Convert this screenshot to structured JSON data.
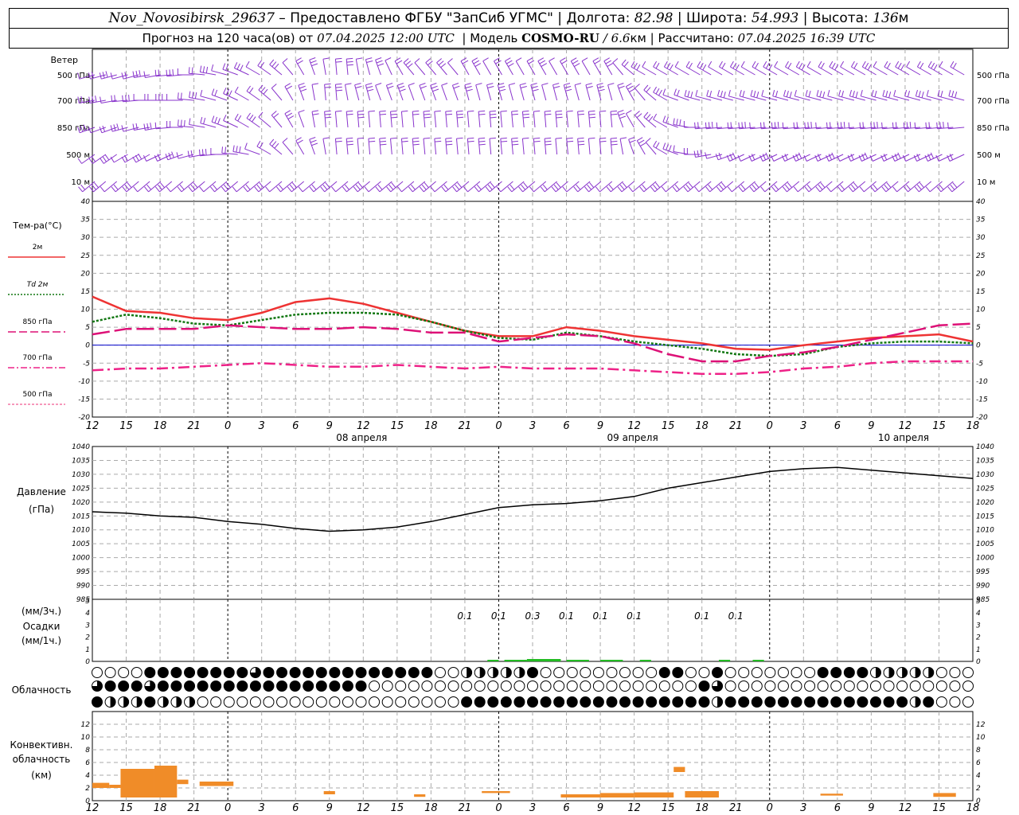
{
  "header": {
    "station": "Nov_Novosibirsk_29637",
    "dash": "–",
    "provided": "Предоставлено ФГБУ \"ЗапСиб УГМС\"",
    "lon_label": "Долгота:",
    "lon": "82.98",
    "lat_label": "Широта:",
    "lat": "54.993",
    "alt_label": "Высота:",
    "alt": "136",
    "alt_unit": "м",
    "sep": "|",
    "forecast_label": "Прогноз на 120 часа(ов) от",
    "run_time": "07.04.2025 12:00 UTC",
    "model_label": "| Модель",
    "model": "COSMO-RU",
    "slash": "/",
    "res": "6.6",
    "res_unit": "км",
    "calc_label": "| Рассчитано:",
    "calc_time": "07.04.2025 16:39 UTC"
  },
  "colors": {
    "t2m": "#ee3333",
    "td2m": "#117711",
    "t850": "#dd1177",
    "t700": "#ee2288",
    "t500": "#ee3377",
    "wind": "#8833cc",
    "pressure": "#000000",
    "zero": "#0000cc",
    "conv": "#f08c28",
    "precip": "#22bb22"
  },
  "wind_panel": {
    "title": "Ветер",
    "levels": [
      "500 гПа",
      "700 гПа",
      "850 гПа",
      "500 м",
      "10  м"
    ]
  },
  "temp_panel": {
    "title": "Тем-ра(°C)",
    "legend": [
      {
        "label": "2м",
        "key": "t2m",
        "style": "solid"
      },
      {
        "label": "Td  2м",
        "key": "td2m",
        "style": "dotted"
      },
      {
        "label": "850 гПа",
        "key": "t850",
        "style": "dash"
      },
      {
        "label": "700 гПа",
        "key": "t700",
        "style": "dashdot"
      },
      {
        "label": "500 гПа",
        "key": "t500",
        "style": "thin"
      }
    ]
  },
  "x_ticks": [
    "12",
    "15",
    "18",
    "21",
    "0",
    "3",
    "6",
    "9",
    "12",
    "15",
    "18",
    "21",
    "0",
    "3",
    "6",
    "9",
    "12",
    "15",
    "18",
    "21",
    "0",
    "3",
    "6",
    "9",
    "12",
    "15",
    "18"
  ],
  "dates": [
    "08 апреля",
    "09 апреля",
    "10 апреля"
  ],
  "pressure_panel": {
    "title": "Давление",
    "unit": "(гПа)"
  },
  "precip_panel": {
    "unit1": "(мм/3ч.)",
    "title": "Осадки",
    "unit2": "(мм/1ч.)",
    "labels": [
      "0.1",
      "0.1",
      "0.3",
      "0.1",
      "0.1",
      "0.1",
      "0.1",
      "0.1"
    ]
  },
  "cloud_panel": {
    "title": "Облачность",
    "rows": [
      "0000444444443444444444444400222224000000000440040000000444422222000",
      "3444344444444444444440000000000000000000000000430000000000000000000",
      "4222422200000000000000000000444444444444444444424444444444444424000"
    ]
  },
  "conv_panel": {
    "title_lines": [
      "Конвективн.",
      "облачность",
      "(км)"
    ]
  },
  "chart_data": [
    {
      "type": "line",
      "title": "Тем-ра(°C)",
      "x": [
        "07.04 12",
        "07.04 15",
        "07.04 18",
        "07.04 21",
        "08.04 00",
        "08.04 03",
        "08.04 06",
        "08.04 09",
        "08.04 12",
        "08.04 15",
        "08.04 18",
        "08.04 21",
        "09.04 00",
        "09.04 03",
        "09.04 06",
        "09.04 09",
        "09.04 12",
        "09.04 15",
        "09.04 18",
        "09.04 21",
        "10.04 00",
        "10.04 03",
        "10.04 06",
        "10.04 09",
        "10.04 12",
        "10.04 15",
        "10.04 18"
      ],
      "ylim": [
        -20,
        40
      ],
      "yticks": [
        -20,
        -15,
        -10,
        -5,
        0,
        5,
        10,
        15,
        20,
        25,
        30,
        35,
        40
      ],
      "series": [
        {
          "name": "2м",
          "values": [
            13.5,
            9.5,
            9,
            7.5,
            7,
            9,
            12,
            13,
            11.5,
            9,
            6.5,
            4,
            2.5,
            2.5,
            5,
            4,
            2.5,
            1.5,
            0.5,
            -1,
            -1.3,
            0,
            1,
            2,
            2.5,
            3,
            1
          ]
        },
        {
          "name": "Td  2м",
          "values": [
            6.5,
            8.5,
            7.5,
            6,
            5.5,
            7,
            8.5,
            9,
            9,
            8.5,
            6.5,
            4,
            2,
            1.5,
            3.5,
            2.5,
            1,
            0,
            -1,
            -2.5,
            -3,
            -2.5,
            -0.5,
            0.5,
            1,
            1,
            0.5
          ]
        },
        {
          "name": "850 гПа",
          "values": [
            3,
            4.5,
            4.5,
            4.5,
            5.5,
            5,
            4.5,
            4.5,
            5,
            4.5,
            3.5,
            3.5,
            1,
            2,
            3,
            2.5,
            0.5,
            -2.5,
            -4.5,
            -4.5,
            -3,
            -2,
            -0.5,
            1.5,
            3.5,
            5.5,
            6
          ]
        },
        {
          "name": "700 гПа",
          "values": [
            -7,
            -6.5,
            -6.5,
            -6,
            -5.5,
            -5,
            -5.5,
            -6,
            -6,
            -5.5,
            -6,
            -6.5,
            -6,
            -6.5,
            -6.5,
            -6.5,
            -7,
            -7.5,
            -8,
            -8,
            -7.5,
            -6.5,
            -6,
            -5,
            -4.5,
            -4.5,
            -4.5
          ]
        }
      ]
    },
    {
      "type": "line",
      "title": "Давление",
      "ylabel": "(гПа)",
      "x": [
        "07.04 12",
        "07.04 15",
        "07.04 18",
        "07.04 21",
        "08.04 00",
        "08.04 03",
        "08.04 06",
        "08.04 09",
        "08.04 12",
        "08.04 15",
        "08.04 18",
        "08.04 21",
        "09.04 00",
        "09.04 03",
        "09.04 06",
        "09.04 09",
        "09.04 12",
        "09.04 15",
        "09.04 18",
        "09.04 21",
        "10.04 00",
        "10.04 03",
        "10.04 06",
        "10.04 09",
        "10.04 12",
        "10.04 15",
        "10.04 18"
      ],
      "ylim": [
        985,
        1040
      ],
      "yticks": [
        985,
        990,
        995,
        1000,
        1005,
        1010,
        1015,
        1020,
        1025,
        1030,
        1035,
        1040
      ],
      "series": [
        {
          "name": "Давление",
          "values": [
            1016.5,
            1016,
            1015,
            1014.5,
            1013,
            1012,
            1010.5,
            1009.5,
            1010,
            1011,
            1013,
            1015.5,
            1018,
            1019,
            1019.5,
            1020.5,
            1022,
            1025,
            1027,
            1029,
            1031,
            1032,
            1032.5,
            1031.5,
            1030.5,
            1029.5,
            1028.5
          ]
        }
      ]
    },
    {
      "type": "bar",
      "title": "Осадки",
      "ylabel": "(мм/3ч.) (мм/1ч.)",
      "ylim": [
        0,
        5
      ],
      "yticks": [
        0,
        1,
        2,
        3,
        4,
        5
      ],
      "labels": [
        "0.1",
        "0.1",
        "0.3",
        "0.1",
        "0.1",
        "0.1",
        "0.1",
        "0.1"
      ],
      "label_hours": [
        33,
        36,
        39,
        42,
        45,
        48,
        54,
        57
      ],
      "bars": [
        {
          "hour": 35.5,
          "w": 1,
          "v": 0.05
        },
        {
          "hour": 37.5,
          "w": 2,
          "v": 0.1
        },
        {
          "hour": 40,
          "w": 3,
          "v": 0.3
        },
        {
          "hour": 43,
          "w": 2,
          "v": 0.15
        },
        {
          "hour": 46,
          "w": 2,
          "v": 0.1
        },
        {
          "hour": 49,
          "w": 1,
          "v": 0.05
        },
        {
          "hour": 56,
          "w": 1,
          "v": 0.05
        },
        {
          "hour": 59,
          "w": 1,
          "v": 0.03
        }
      ]
    },
    {
      "type": "bar",
      "title": "Конвективн. облачность",
      "ylabel": "(км)",
      "ylim": [
        0,
        14
      ],
      "yticks": [
        0,
        2,
        4,
        6,
        8,
        10,
        12
      ],
      "bars": [
        {
          "h0": 0,
          "h1": 1.5,
          "lo": 2,
          "hi": 2.8
        },
        {
          "h0": 1.5,
          "h1": 2.5,
          "lo": 2,
          "hi": 2.5
        },
        {
          "h0": 2.5,
          "h1": 5.5,
          "lo": 0.5,
          "hi": 5
        },
        {
          "h0": 5.5,
          "h1": 7.5,
          "lo": 0.5,
          "hi": 5.5
        },
        {
          "h0": 7.5,
          "h1": 8.5,
          "lo": 2.6,
          "hi": 3.3
        },
        {
          "h0": 9.5,
          "h1": 12.5,
          "lo": 2.3,
          "hi": 3
        },
        {
          "h0": 20.5,
          "h1": 21.5,
          "lo": 1,
          "hi": 1.5
        },
        {
          "h0": 28.5,
          "h1": 29.5,
          "lo": 0.6,
          "hi": 1
        },
        {
          "h0": 34.5,
          "h1": 37,
          "lo": 1.2,
          "hi": 1.5
        },
        {
          "h0": 41.5,
          "h1": 45,
          "lo": 0.5,
          "hi": 1
        },
        {
          "h0": 45,
          "h1": 48,
          "lo": 0.5,
          "hi": 1.2
        },
        {
          "h0": 48,
          "h1": 51.5,
          "lo": 0.5,
          "hi": 1.3
        },
        {
          "h0": 51.5,
          "h1": 52.5,
          "lo": 4.5,
          "hi": 5.3
        },
        {
          "h0": 52.5,
          "h1": 55.5,
          "lo": 0.5,
          "hi": 1.5
        },
        {
          "h0": 64.5,
          "h1": 66.5,
          "lo": 0.8,
          "hi": 1.1
        },
        {
          "h0": 74.5,
          "h1": 76.5,
          "lo": 0.6,
          "hi": 1.2
        }
      ]
    }
  ]
}
